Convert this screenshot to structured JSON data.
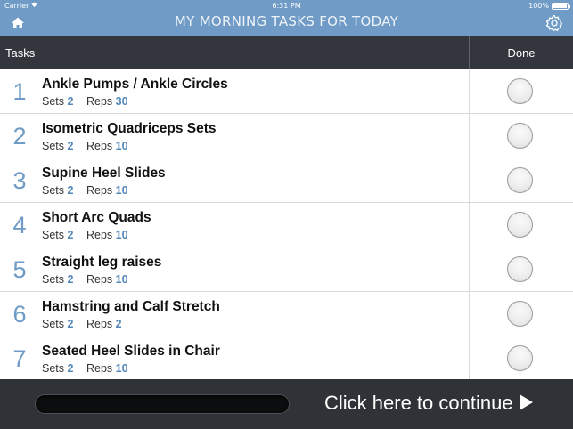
{
  "status_bar": {
    "carrier": "Carrier",
    "time": "6:31 PM",
    "battery": "100%"
  },
  "nav": {
    "title": "MY MORNING TASKS FOR TODAY",
    "home_icon": "home-icon",
    "settings_icon": "gear-icon"
  },
  "table": {
    "headers": {
      "tasks": "Tasks",
      "done": "Done"
    },
    "sets_label": "Sets",
    "reps_label": "Reps",
    "rows": [
      {
        "num": "1",
        "title": "Ankle Pumps / Ankle Circles",
        "sets": "2",
        "reps": "30",
        "done": false
      },
      {
        "num": "2",
        "title": "Isometric Quadriceps Sets",
        "sets": "2",
        "reps": "10",
        "done": false
      },
      {
        "num": "3",
        "title": "Supine Heel Slides",
        "sets": "2",
        "reps": "10",
        "done": false
      },
      {
        "num": "4",
        "title": "Short Arc Quads",
        "sets": "2",
        "reps": "10",
        "done": false
      },
      {
        "num": "5",
        "title": "Straight leg raises",
        "sets": "2",
        "reps": "10",
        "done": false
      },
      {
        "num": "6",
        "title": "Hamstring and Calf Stretch",
        "sets": "2",
        "reps": "2",
        "done": false
      },
      {
        "num": "7",
        "title": "Seated Heel Slides in Chair",
        "sets": "2",
        "reps": "10",
        "done": false
      }
    ]
  },
  "footer": {
    "progress": 0,
    "continue_label": "Click here to continue"
  },
  "colors": {
    "accent": "#6f9bc6",
    "header_bg": "#33373d",
    "footer_bg": "#2f3337",
    "value_blue": "#5487ba"
  }
}
